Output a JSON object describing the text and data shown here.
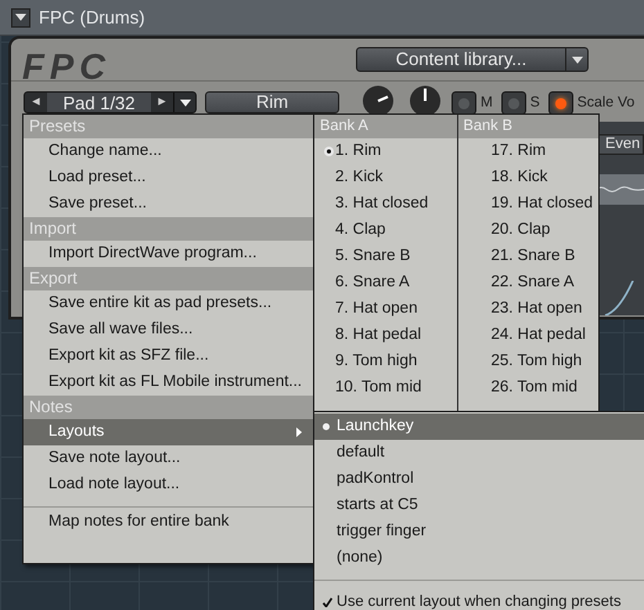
{
  "window": {
    "title": "FPC (Drums)"
  },
  "plugin": {
    "logo": "FPC",
    "content_library": "Content library...",
    "pad_selector": {
      "prev": "◄",
      "label": "Pad 1/32",
      "next": "►"
    },
    "pad_name": "Rim",
    "toggles": [
      {
        "label": "M",
        "on": false
      },
      {
        "label": "S",
        "on": false
      },
      {
        "label": "Scale Vo",
        "on": true
      }
    ],
    "side_button": "Even"
  },
  "menu": {
    "sections": [
      {
        "header": "Presets",
        "items": [
          {
            "label": "Change name...",
            "highlighted": false
          },
          {
            "label": "Load preset...",
            "highlighted": false
          },
          {
            "label": "Save preset...",
            "highlighted": false
          }
        ]
      },
      {
        "header": "Import",
        "items": [
          {
            "label": "Import DirectWave program...",
            "highlighted": false
          }
        ]
      },
      {
        "header": "Export",
        "items": [
          {
            "label": "Save entire kit as pad presets...",
            "highlighted": false
          },
          {
            "label": "Save all wave files...",
            "highlighted": false
          },
          {
            "label": "Export kit as SFZ file...",
            "highlighted": false
          },
          {
            "label": "Export kit as FL Mobile instrument...",
            "highlighted": false
          }
        ]
      },
      {
        "header": "Notes",
        "items": [
          {
            "label": "Layouts",
            "highlighted": true,
            "submenu": true
          },
          {
            "label": "Save note layout...",
            "highlighted": false
          },
          {
            "label": "Load note layout...",
            "highlighted": false
          },
          {
            "label": "Map notes for entire bank",
            "highlighted": false,
            "separator_before": true
          }
        ]
      }
    ]
  },
  "bank_submenu": {
    "banks": [
      {
        "header": "Bank A",
        "pads": [
          {
            "label": "1. Rim",
            "selected": true
          },
          {
            "label": "2. Kick",
            "selected": false
          },
          {
            "label": "3. Hat closed",
            "selected": false
          },
          {
            "label": "4. Clap",
            "selected": false
          },
          {
            "label": "5. Snare B",
            "selected": false
          },
          {
            "label": "6. Snare A",
            "selected": false
          },
          {
            "label": "7. Hat open",
            "selected": false
          },
          {
            "label": "8. Hat pedal",
            "selected": false
          },
          {
            "label": "9. Tom high",
            "selected": false
          },
          {
            "label": "10. Tom mid",
            "selected": false
          }
        ]
      },
      {
        "header": "Bank B",
        "pads": [
          {
            "label": "17. Rim",
            "selected": false
          },
          {
            "label": "18. Kick",
            "selected": false
          },
          {
            "label": "19. Hat closed",
            "selected": false
          },
          {
            "label": "20. Clap",
            "selected": false
          },
          {
            "label": "21. Snare B",
            "selected": false
          },
          {
            "label": "22. Snare A",
            "selected": false
          },
          {
            "label": "23. Hat open",
            "selected": false
          },
          {
            "label": "24. Hat pedal",
            "selected": false
          },
          {
            "label": "25. Tom high",
            "selected": false
          },
          {
            "label": "26. Tom mid",
            "selected": false
          }
        ]
      }
    ]
  },
  "layouts_submenu": {
    "items": [
      {
        "label": "Launchkey",
        "selected": true
      },
      {
        "label": "default",
        "selected": false
      },
      {
        "label": "padKontrol",
        "selected": false
      },
      {
        "label": "starts at C5",
        "selected": false
      },
      {
        "label": "trigger finger",
        "selected": false
      },
      {
        "label": "(none)",
        "selected": false
      }
    ],
    "option": {
      "label": "Use current layout when changing presets",
      "checked": true
    }
  }
}
